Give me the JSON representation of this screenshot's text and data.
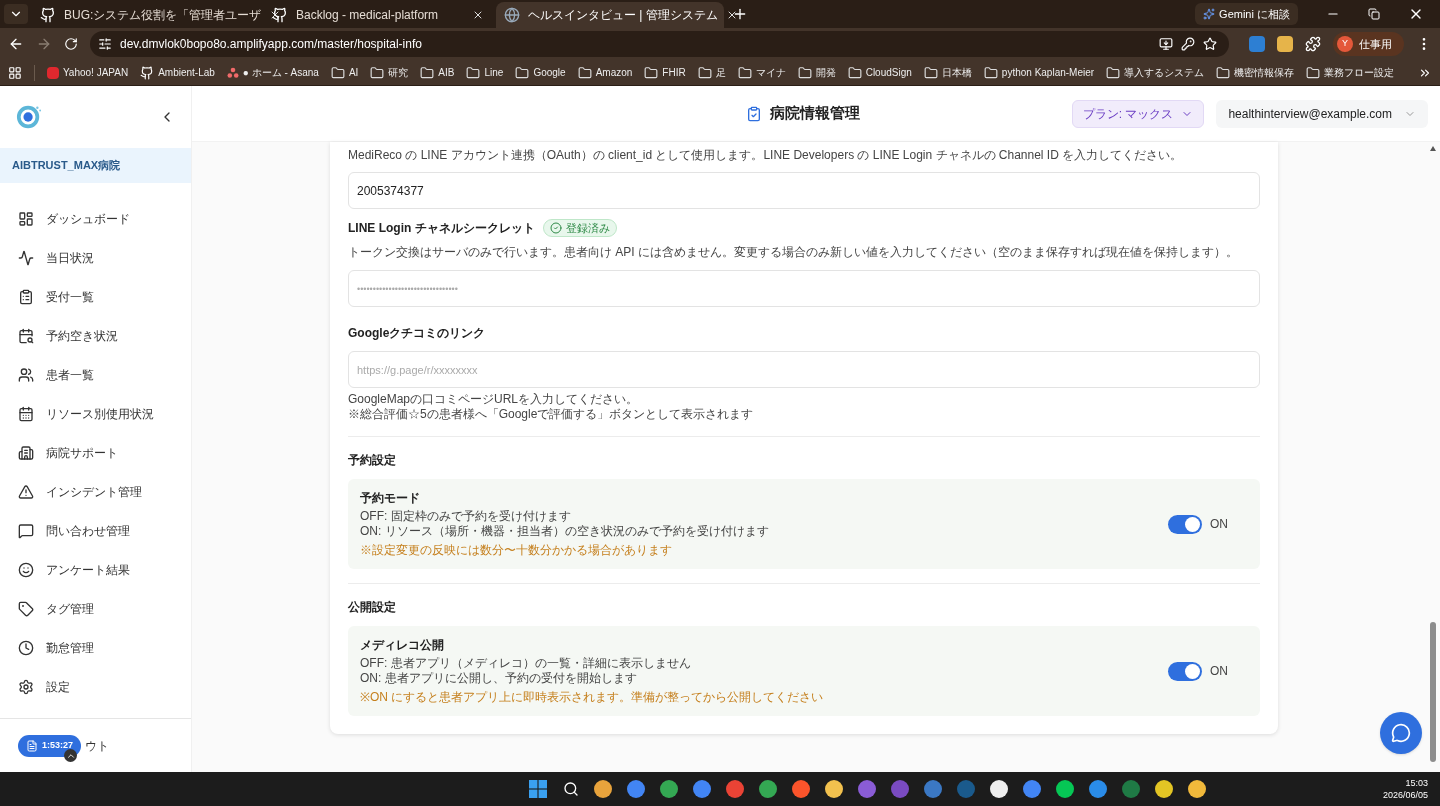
{
  "browser": {
    "tabs": [
      {
        "title": "BUG:システム役割を「管理者ユーザ",
        "selected": false,
        "kind": "github"
      },
      {
        "title": "Backlog - medical-platform",
        "selected": false,
        "kind": "github"
      },
      {
        "title": "ヘルスインタビュー | 管理システム",
        "selected": true,
        "kind": "site"
      }
    ],
    "gemini": "Gemini に相談",
    "url": "dev.dmvlok0bopo8o.amplifyapp.com/master/hospital-info",
    "profile": {
      "initial": "Y",
      "label": "仕事用"
    },
    "bookmarks": [
      {
        "label": "Yahoo! JAPAN",
        "kind": "yahoo"
      },
      {
        "label": "Ambient-Lab",
        "kind": "github"
      },
      {
        "label": "● ホーム - Asana",
        "kind": "asana"
      },
      {
        "label": "AI",
        "kind": "folder"
      },
      {
        "label": "研究",
        "kind": "folder"
      },
      {
        "label": "AIB",
        "kind": "folder"
      },
      {
        "label": "Line",
        "kind": "folder"
      },
      {
        "label": "Google",
        "kind": "folder"
      },
      {
        "label": "Amazon",
        "kind": "folder"
      },
      {
        "label": "FHIR",
        "kind": "folder"
      },
      {
        "label": "足",
        "kind": "folder"
      },
      {
        "label": "マイナ",
        "kind": "folder"
      },
      {
        "label": "開発",
        "kind": "folder"
      },
      {
        "label": "CloudSign",
        "kind": "folder"
      },
      {
        "label": "日本橋",
        "kind": "folder"
      },
      {
        "label": "python Kaplan-Meier",
        "kind": "folder"
      },
      {
        "label": "導入するシステム",
        "kind": "folder"
      },
      {
        "label": "機密情報保存",
        "kind": "folder"
      },
      {
        "label": "業務フロー設定",
        "kind": "folder"
      }
    ]
  },
  "app": {
    "hospital": "AIBTRUST_MAX病院",
    "page_title": "病院情報管理",
    "plan": "プラン: マックス",
    "account": "healthinterview@example.com",
    "nav": [
      {
        "label": "ダッシュボード",
        "kind": "dashboard"
      },
      {
        "label": "当日状況",
        "kind": "activity"
      },
      {
        "label": "受付一覧",
        "kind": "clipboard"
      },
      {
        "label": "予約空き状況",
        "kind": "calendar-search"
      },
      {
        "label": "患者一覧",
        "kind": "users"
      },
      {
        "label": "リソース別使用状況",
        "kind": "calendar"
      },
      {
        "label": "病院サポート",
        "kind": "building"
      },
      {
        "label": "インシデント管理",
        "kind": "warning"
      },
      {
        "label": "問い合わせ管理",
        "kind": "message"
      },
      {
        "label": "アンケート結果",
        "kind": "smile"
      },
      {
        "label": "タグ管理",
        "kind": "tag"
      },
      {
        "label": "勤怠管理",
        "kind": "clock"
      },
      {
        "label": "設定",
        "kind": "settings"
      }
    ],
    "logout_partial": "ウト",
    "recording_badge": "1:53:27"
  },
  "form": {
    "client_id": {
      "help": "MediReco の LINE アカウント連携（OAuth）の client_id として使用します。LINE Developers の LINE Login チャネルの Channel ID を入力してください。",
      "value": "2005374377"
    },
    "secret": {
      "label": "LINE Login チャネルシークレット",
      "badge": "登録済み",
      "help": "トークン交換はサーバのみで行います。患者向け API には含めません。変更する場合のみ新しい値を入力してください（空のまま保存すれば現在値を保持します）。",
      "placeholder": "••••••••••••••••••••••••••••••••"
    },
    "google_review": {
      "label": "Googleクチコミのリンク",
      "placeholder": "https://g.page/r/xxxxxxxx",
      "notes": [
        "GoogleMapの口コミページURLを入力してください。",
        "※総合評価☆5の患者様へ「Googleで評価する」ボタンとして表示されます"
      ]
    },
    "sections": [
      {
        "heading": "予約設定",
        "title": "予約モード",
        "lines": [
          "OFF: 固定枠のみで予約を受け付けます",
          "ON: リソース（場所・機器・担当者）の空き状況のみで予約を受け付けます"
        ],
        "note": "※設定変更の反映には数分〜十数分かかる場合があります",
        "on": true,
        "state_label": "ON"
      },
      {
        "heading": "公開設定",
        "title": "メディレコ公開",
        "lines": [
          "OFF: 患者アプリ（メディレコ）の一覧・詳細に表示しません",
          "ON: 患者アプリに公開し、予約の受付を開始します"
        ],
        "note": "※ON にすると患者アプリ上に即時表示されます。準備が整ってから公開してください",
        "on": true,
        "state_label": "ON"
      }
    ]
  },
  "taskbar": {
    "time": "15:03",
    "date": "2026/06/05"
  }
}
